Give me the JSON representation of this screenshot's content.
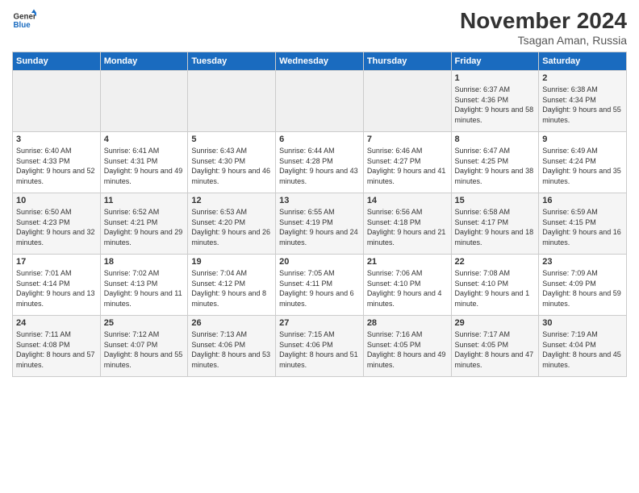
{
  "logo": {
    "line1": "General",
    "line2": "Blue"
  },
  "title": "November 2024",
  "subtitle": "Tsagan Aman, Russia",
  "headers": [
    "Sunday",
    "Monday",
    "Tuesday",
    "Wednesday",
    "Thursday",
    "Friday",
    "Saturday"
  ],
  "weeks": [
    [
      {
        "day": "",
        "info": ""
      },
      {
        "day": "",
        "info": ""
      },
      {
        "day": "",
        "info": ""
      },
      {
        "day": "",
        "info": ""
      },
      {
        "day": "",
        "info": ""
      },
      {
        "day": "1",
        "info": "Sunrise: 6:37 AM\nSunset: 4:36 PM\nDaylight: 9 hours and 58 minutes."
      },
      {
        "day": "2",
        "info": "Sunrise: 6:38 AM\nSunset: 4:34 PM\nDaylight: 9 hours and 55 minutes."
      }
    ],
    [
      {
        "day": "3",
        "info": "Sunrise: 6:40 AM\nSunset: 4:33 PM\nDaylight: 9 hours and 52 minutes."
      },
      {
        "day": "4",
        "info": "Sunrise: 6:41 AM\nSunset: 4:31 PM\nDaylight: 9 hours and 49 minutes."
      },
      {
        "day": "5",
        "info": "Sunrise: 6:43 AM\nSunset: 4:30 PM\nDaylight: 9 hours and 46 minutes."
      },
      {
        "day": "6",
        "info": "Sunrise: 6:44 AM\nSunset: 4:28 PM\nDaylight: 9 hours and 43 minutes."
      },
      {
        "day": "7",
        "info": "Sunrise: 6:46 AM\nSunset: 4:27 PM\nDaylight: 9 hours and 41 minutes."
      },
      {
        "day": "8",
        "info": "Sunrise: 6:47 AM\nSunset: 4:25 PM\nDaylight: 9 hours and 38 minutes."
      },
      {
        "day": "9",
        "info": "Sunrise: 6:49 AM\nSunset: 4:24 PM\nDaylight: 9 hours and 35 minutes."
      }
    ],
    [
      {
        "day": "10",
        "info": "Sunrise: 6:50 AM\nSunset: 4:23 PM\nDaylight: 9 hours and 32 minutes."
      },
      {
        "day": "11",
        "info": "Sunrise: 6:52 AM\nSunset: 4:21 PM\nDaylight: 9 hours and 29 minutes."
      },
      {
        "day": "12",
        "info": "Sunrise: 6:53 AM\nSunset: 4:20 PM\nDaylight: 9 hours and 26 minutes."
      },
      {
        "day": "13",
        "info": "Sunrise: 6:55 AM\nSunset: 4:19 PM\nDaylight: 9 hours and 24 minutes."
      },
      {
        "day": "14",
        "info": "Sunrise: 6:56 AM\nSunset: 4:18 PM\nDaylight: 9 hours and 21 minutes."
      },
      {
        "day": "15",
        "info": "Sunrise: 6:58 AM\nSunset: 4:17 PM\nDaylight: 9 hours and 18 minutes."
      },
      {
        "day": "16",
        "info": "Sunrise: 6:59 AM\nSunset: 4:15 PM\nDaylight: 9 hours and 16 minutes."
      }
    ],
    [
      {
        "day": "17",
        "info": "Sunrise: 7:01 AM\nSunset: 4:14 PM\nDaylight: 9 hours and 13 minutes."
      },
      {
        "day": "18",
        "info": "Sunrise: 7:02 AM\nSunset: 4:13 PM\nDaylight: 9 hours and 11 minutes."
      },
      {
        "day": "19",
        "info": "Sunrise: 7:04 AM\nSunset: 4:12 PM\nDaylight: 9 hours and 8 minutes."
      },
      {
        "day": "20",
        "info": "Sunrise: 7:05 AM\nSunset: 4:11 PM\nDaylight: 9 hours and 6 minutes."
      },
      {
        "day": "21",
        "info": "Sunrise: 7:06 AM\nSunset: 4:10 PM\nDaylight: 9 hours and 4 minutes."
      },
      {
        "day": "22",
        "info": "Sunrise: 7:08 AM\nSunset: 4:10 PM\nDaylight: 9 hours and 1 minute."
      },
      {
        "day": "23",
        "info": "Sunrise: 7:09 AM\nSunset: 4:09 PM\nDaylight: 8 hours and 59 minutes."
      }
    ],
    [
      {
        "day": "24",
        "info": "Sunrise: 7:11 AM\nSunset: 4:08 PM\nDaylight: 8 hours and 57 minutes."
      },
      {
        "day": "25",
        "info": "Sunrise: 7:12 AM\nSunset: 4:07 PM\nDaylight: 8 hours and 55 minutes."
      },
      {
        "day": "26",
        "info": "Sunrise: 7:13 AM\nSunset: 4:06 PM\nDaylight: 8 hours and 53 minutes."
      },
      {
        "day": "27",
        "info": "Sunrise: 7:15 AM\nSunset: 4:06 PM\nDaylight: 8 hours and 51 minutes."
      },
      {
        "day": "28",
        "info": "Sunrise: 7:16 AM\nSunset: 4:05 PM\nDaylight: 8 hours and 49 minutes."
      },
      {
        "day": "29",
        "info": "Sunrise: 7:17 AM\nSunset: 4:05 PM\nDaylight: 8 hours and 47 minutes."
      },
      {
        "day": "30",
        "info": "Sunrise: 7:19 AM\nSunset: 4:04 PM\nDaylight: 8 hours and 45 minutes."
      }
    ]
  ]
}
